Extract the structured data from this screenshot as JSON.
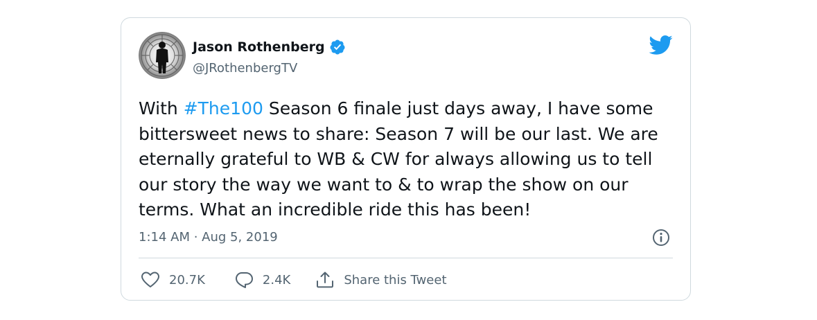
{
  "tweet": {
    "author": {
      "name": "Jason Rothenberg",
      "handle": "@JRothenbergTV",
      "verified": true
    },
    "text_parts": {
      "before_hashtag": "With ",
      "hashtag": "#The100",
      "after_hashtag": " Season 6 finale just days away, I have some bittersweet news to share: Season 7 will be our last. We are eternally grateful to WB & CW for always allowing us to tell our story the way we want to & to wrap the show on our terms. What an incredible ride this has been!"
    },
    "timestamp": "1:14 AM · Aug 5, 2019",
    "actions": {
      "likes": "20.7K",
      "replies": "2.4K",
      "share_label": "Share this Tweet"
    }
  },
  "icons": {
    "brand": "twitter-bird-icon",
    "verified": "verified-badge-icon",
    "info": "info-icon",
    "like": "heart-icon",
    "reply": "reply-bubble-icon",
    "share": "share-icon"
  },
  "colors": {
    "accent": "#1d9bf0",
    "text": "#0f1419",
    "secondary": "#536471",
    "border": "#cfd9de"
  }
}
